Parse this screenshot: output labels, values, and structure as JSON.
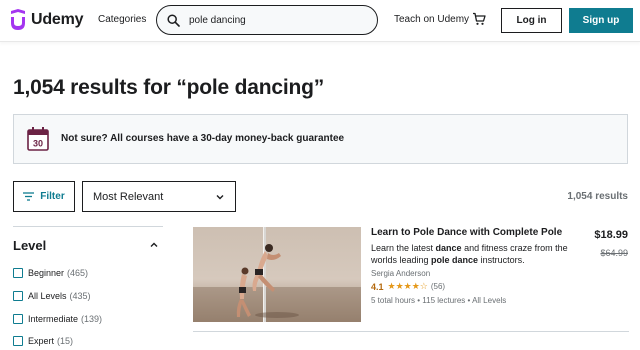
{
  "brand": {
    "name": "Udemy",
    "accent": "#a435f0",
    "primary_button": "#0f7c90"
  },
  "header": {
    "categories_label": "Categories",
    "search": {
      "value": "pole dancing",
      "placeholder": "Search for anything"
    },
    "teach_label": "Teach on Udemy",
    "login_label": "Log in",
    "signup_label": "Sign up"
  },
  "results_title": "1,054 results for “pole dancing”",
  "banner": {
    "text": "Not sure? All courses have a 30-day money-back guarantee",
    "calendar_number": "30"
  },
  "toolbar": {
    "filter_label": "Filter",
    "sort_value": "Most Relevant",
    "results_count": "1,054 results"
  },
  "sidebar": {
    "heading": "Level",
    "items": [
      {
        "label": "Beginner",
        "count": "(465)"
      },
      {
        "label": "All Levels",
        "count": "(435)"
      },
      {
        "label": "Intermediate",
        "count": "(139)"
      },
      {
        "label": "Expert",
        "count": "(15)"
      }
    ]
  },
  "course": {
    "title": "Learn to Pole Dance with Complete Pole",
    "desc_parts": [
      "Learn the latest ",
      "dance",
      " and fitness craze from the worlds leading ",
      "pole dance",
      " instructors."
    ],
    "instructor": "Sergia Anderson",
    "rating": "4.1",
    "stars": "★★★★☆",
    "rating_count": "(56)",
    "meta": "5 total hours • 115 lectures • All Levels",
    "price": "$18.99",
    "old_price": "$64.99"
  },
  "icons": {
    "logo": "udemy-logo-icon",
    "search": "search-icon",
    "cart": "cart-icon",
    "calendar": "calendar-icon",
    "filter": "filter-icon",
    "sort_chevron": "chevron-down-icon",
    "level_chevron": "chevron-up-icon"
  }
}
